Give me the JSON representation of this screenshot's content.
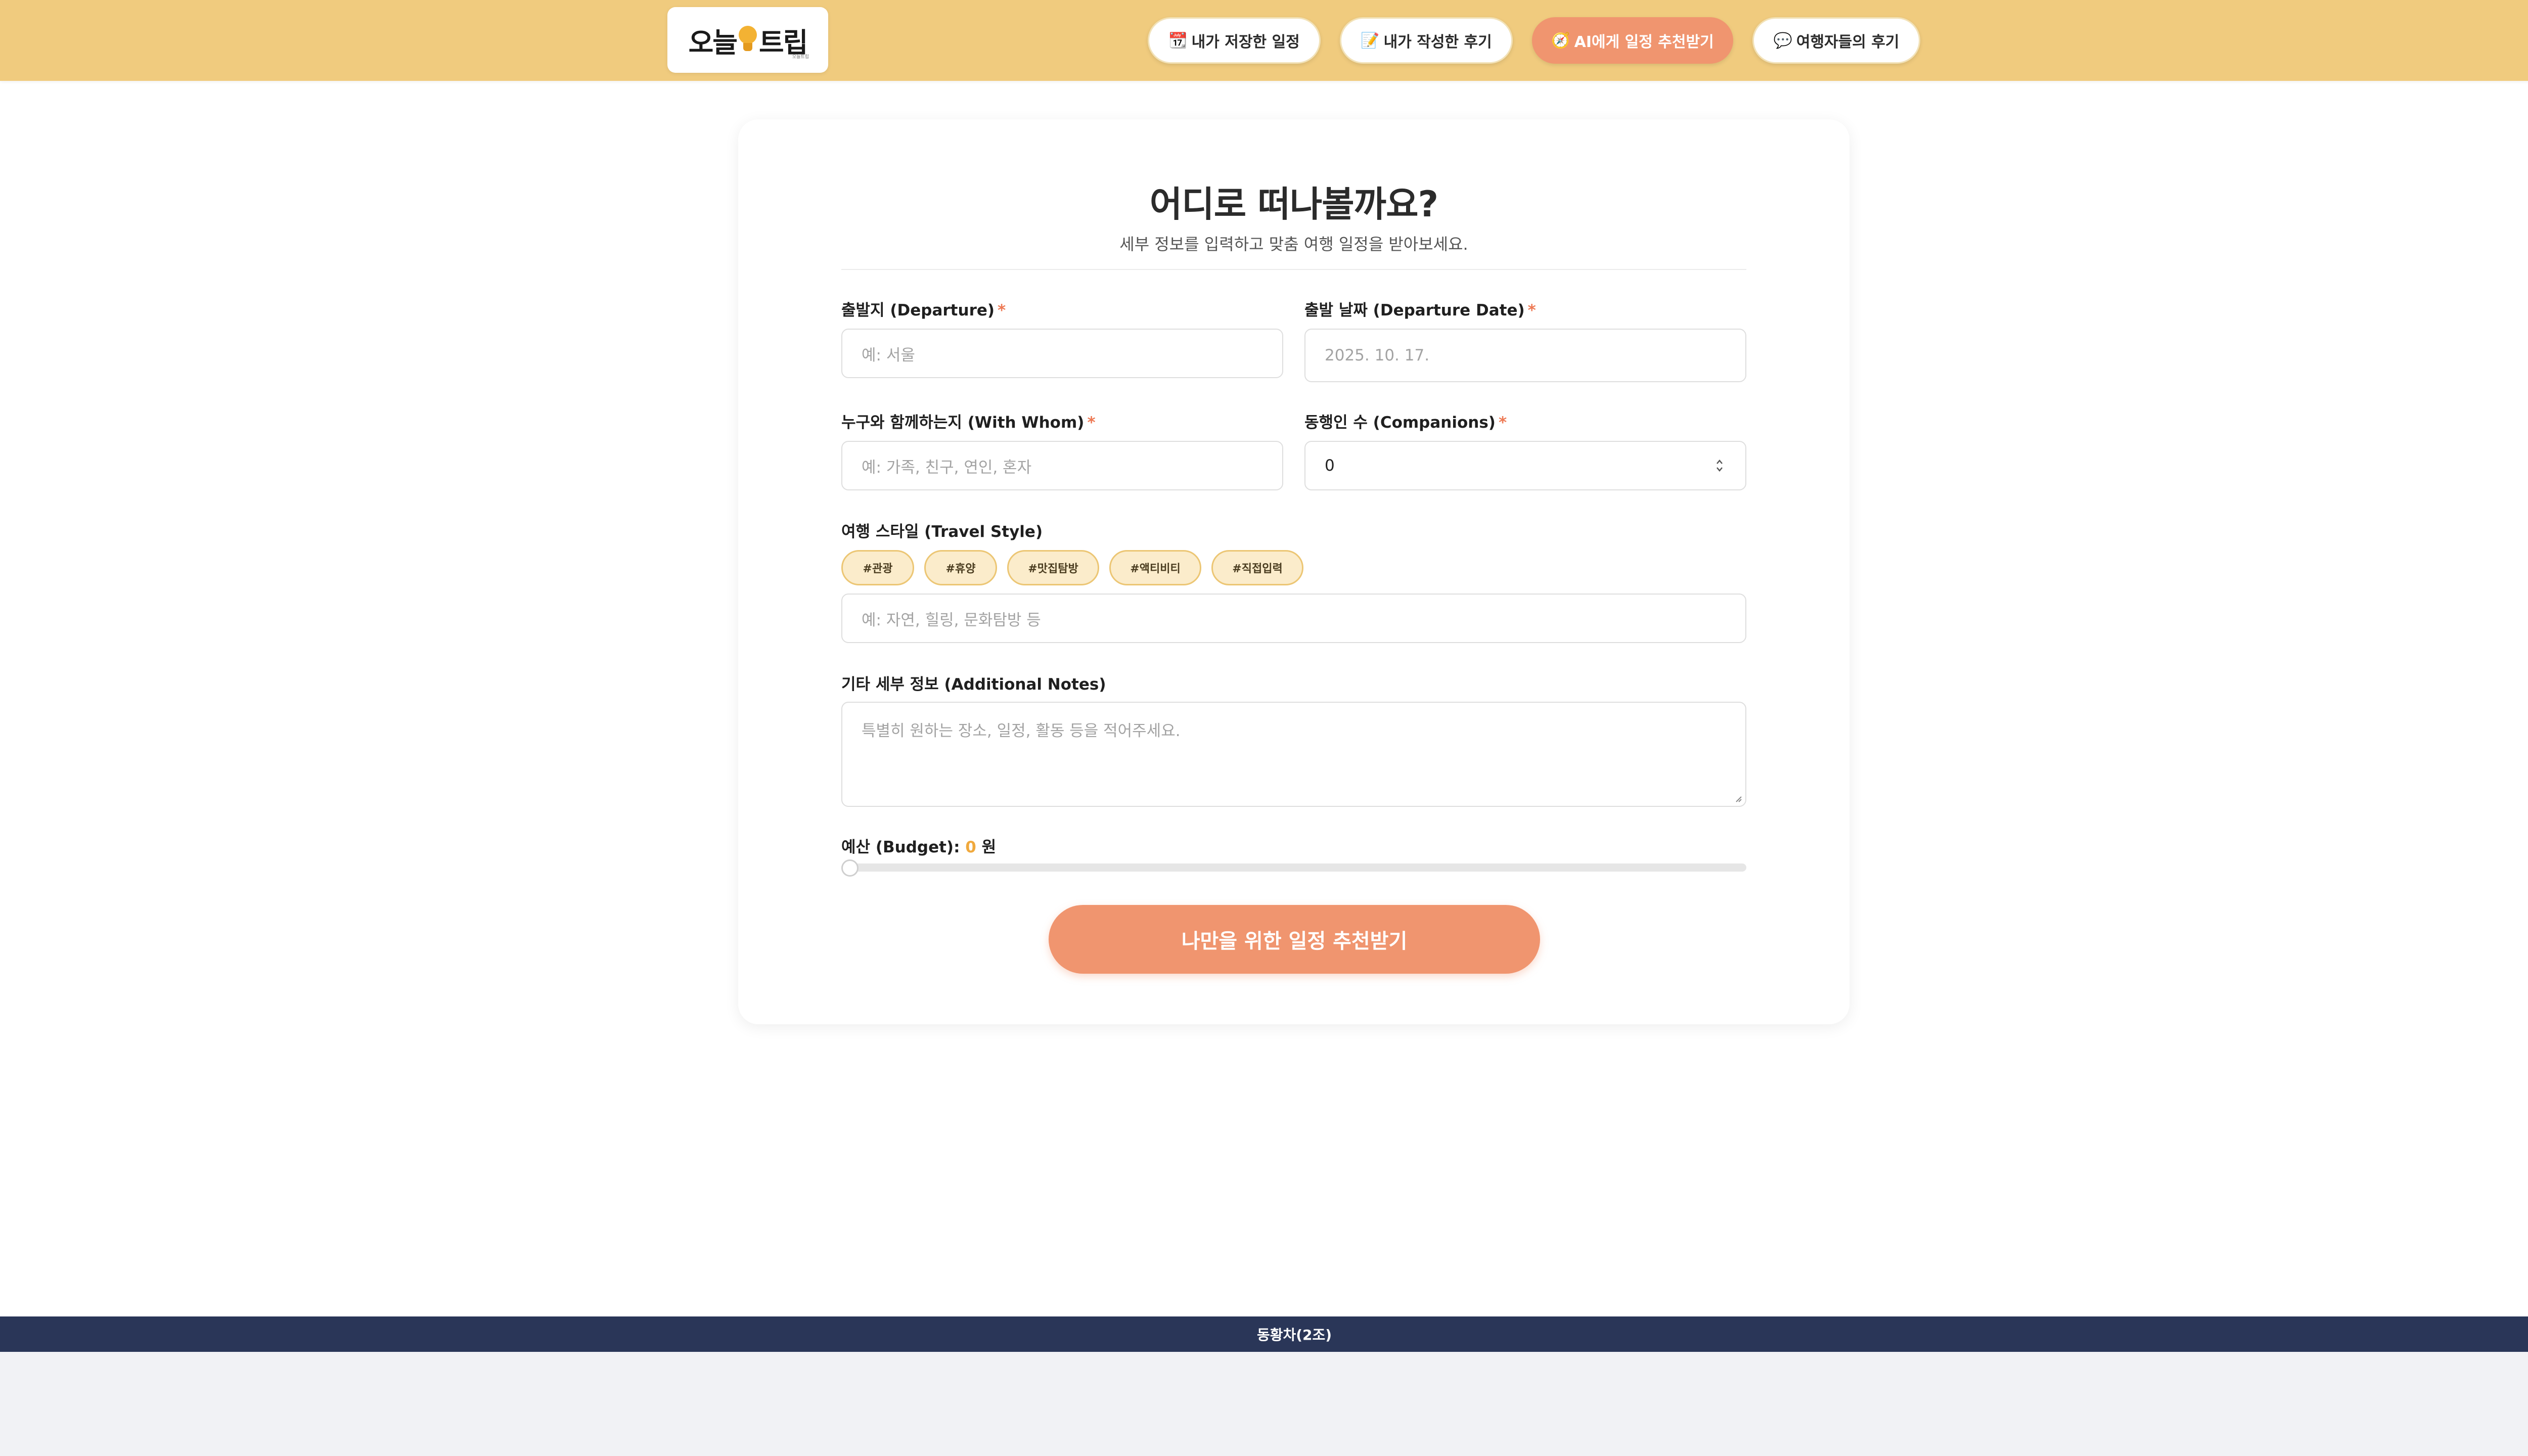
{
  "header": {
    "logo_text": "오늘트립",
    "logo_subtext": "오늘트립",
    "nav": [
      {
        "icon": "📆",
        "label": "내가 저장한 일정"
      },
      {
        "icon": "📝",
        "label": "내가 작성한 후기"
      },
      {
        "icon": "🧭",
        "label": "AI에게 일정 추천받기"
      },
      {
        "icon": "💬",
        "label": "여행자들의 후기"
      }
    ]
  },
  "form": {
    "title": "어디로 떠나볼까요?",
    "subtitle": "세부 정보를 입력하고 맞춤 여행 일정을 받아보세요.",
    "required_mark": "*",
    "departure": {
      "label": "출발지 (Departure)",
      "placeholder": "예: 서울"
    },
    "date": {
      "label": "출발 날짜 (Departure Date)",
      "placeholder": "2025. 10. 17."
    },
    "with_whom": {
      "label": "누구와 함께하는지 (With Whom)",
      "placeholder": "예: 가족, 친구, 연인, 혼자"
    },
    "companions": {
      "label": "동행인 수 (Companions)",
      "value": "0"
    },
    "style": {
      "label": "여행 스타일 (Travel Style)",
      "tags": [
        "#관광",
        "#휴양",
        "#맛집탐방",
        "#액티비티",
        "#직접입력"
      ],
      "placeholder": "예: 자연, 힐링, 문화탐방 등"
    },
    "notes": {
      "label": "기타 세부 정보 (Additional Notes)",
      "placeholder": "특별히 원하는 장소, 일정, 활동 등을 적어주세요."
    },
    "budget": {
      "label": "예산 (Budget):",
      "value": "0",
      "unit": "원",
      "slider_fraction": 0
    },
    "submit_label": "나만을 위한 일정 추천받기"
  },
  "footer": {
    "text": "동황차(2조)"
  },
  "colors": {
    "header_bg": "#f0cb7e",
    "accent": "#f0956f",
    "footer_bg": "#2a3658"
  }
}
